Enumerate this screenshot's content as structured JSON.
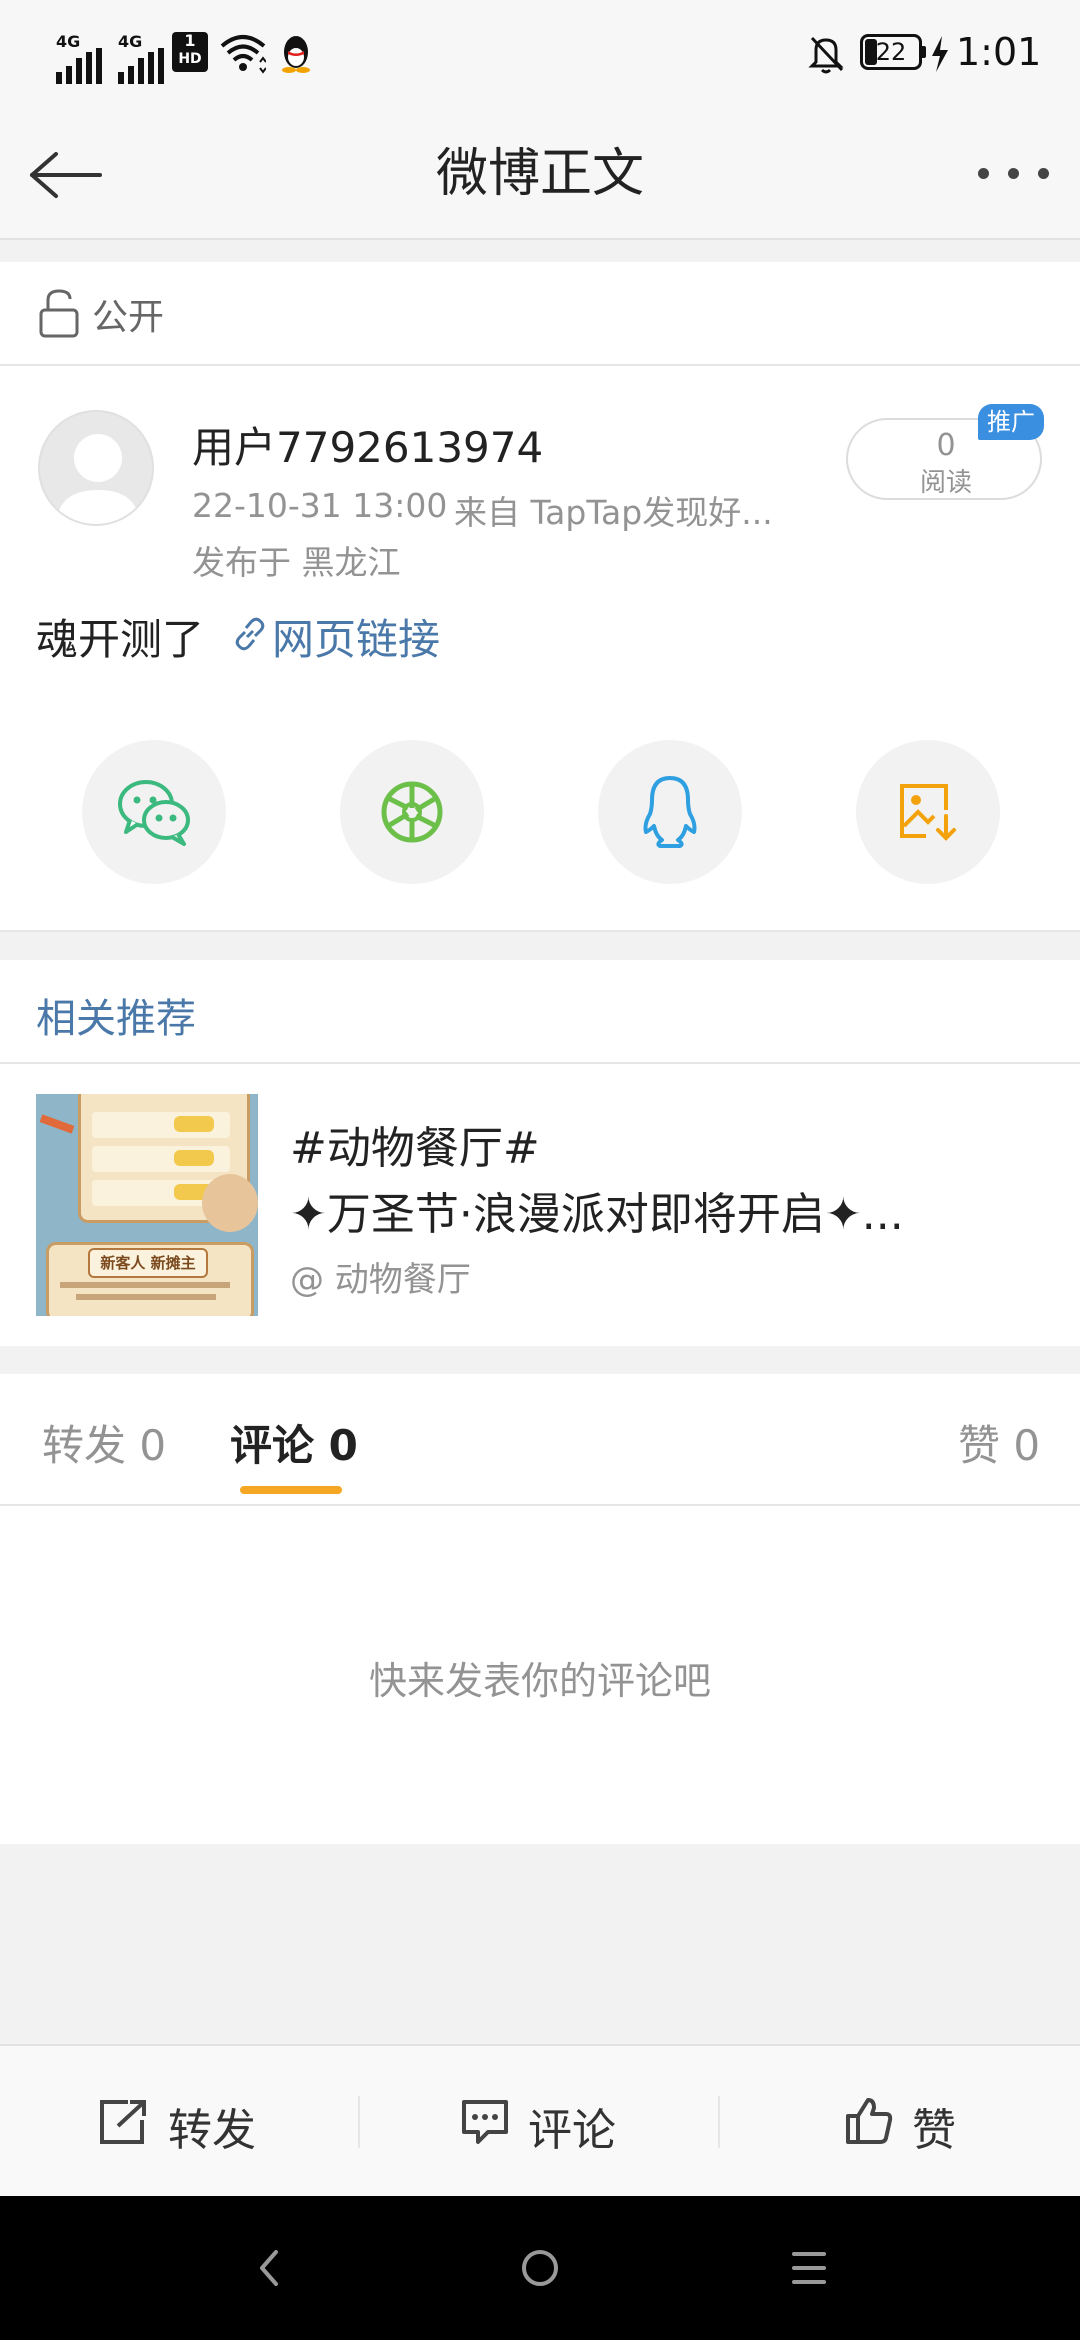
{
  "status_bar": {
    "signal1_label": "4G",
    "signal2_label": "4G",
    "hd_label": "1",
    "hd_sub": "HD",
    "battery": "22",
    "time": "1:01"
  },
  "nav": {
    "title": "微博正文",
    "back_icon": "back-arrow-icon",
    "more_icon": "more-dots-icon"
  },
  "visibility": {
    "label": "公开",
    "icon": "unlock-icon"
  },
  "post": {
    "username": "用户7792613974",
    "time": "22-10-31 13:00",
    "source": "来自 TapTap发现好...",
    "location": "发布于 黑龙江",
    "read_count": "0",
    "read_label": "阅读",
    "promo_badge": "推广",
    "text": "魂开测了",
    "link_text": "网页链接"
  },
  "share": {
    "icons": [
      "wechat-icon",
      "moments-icon",
      "qq-icon",
      "save-image-icon"
    ],
    "colors": {
      "wechat": "#3cb97f",
      "moments": "#6cc04a",
      "qq": "#2e9fe0",
      "save": "#f3a20c"
    }
  },
  "related": {
    "header": "相关推荐",
    "item": {
      "title_line1": "#动物餐厅#",
      "title_line2": "✦万圣节·浪漫派对即将开启✦...",
      "author": "@ 动物餐厅",
      "thumb_text": "新客人 新摊主"
    }
  },
  "tabs": {
    "repost": "转发 0",
    "comment": "评论 0",
    "like": "赞 0",
    "active_color": "#f5a623"
  },
  "comments": {
    "empty_text": "快来发表你的评论吧"
  },
  "bottom_bar": {
    "repost": "转发",
    "comment": "评论",
    "like": "赞"
  }
}
